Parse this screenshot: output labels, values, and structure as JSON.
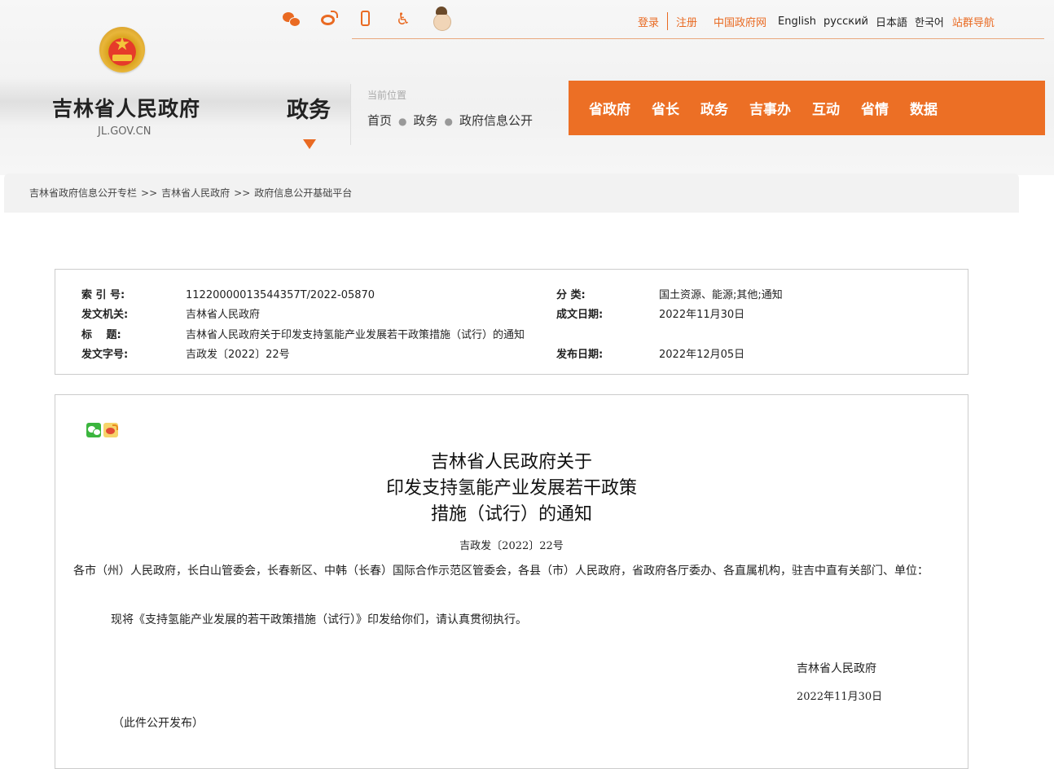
{
  "header": {
    "site_name": "吉林省人民政府",
    "site_domain": "JL.GOV.CN",
    "section_title": "政务",
    "location_label": "当前位置",
    "location_path": [
      "首页",
      "政务",
      "政府信息公开"
    ],
    "top_links": {
      "login": "登录",
      "register": "注册",
      "central_gov": "中国政府网",
      "english": "English",
      "russian": "русский",
      "japanese": "日本語",
      "korean": "한국어",
      "site_nav": "站群导航"
    },
    "icons": [
      "wechat-icon",
      "weibo-icon",
      "mobile-icon",
      "accessibility-icon",
      "elderly-mode-icon"
    ],
    "accent_color": "#ec6f25"
  },
  "main_nav": [
    "省政府",
    "省长",
    "政务",
    "吉事办",
    "互动",
    "省情",
    "数据"
  ],
  "breadcrumb": {
    "items": [
      "吉林省政府信息公开专栏",
      "吉林省人民政府",
      "政府信息公开基础平台"
    ],
    "separator": ">>"
  },
  "info": {
    "index_label": "索 引 号:",
    "index_value": "11220000013544357T/2022-05870",
    "category_label": "分 类:",
    "category_value": "国土资源、能源;其他;通知",
    "issuer_label": "发文机关:",
    "issuer_value": "吉林省人民政府",
    "written_date_label": "成文日期:",
    "written_date_value": "2022年11月30日",
    "title_label": "标　  题:",
    "title_value": "吉林省人民政府关于印发支持氢能产业发展若干政策措施（试行）的通知",
    "doc_number_label": "发文字号:",
    "doc_number_value": "吉政发〔2022〕22号",
    "publish_date_label": "发布日期:",
    "publish_date_value": "2022年12月05日"
  },
  "document": {
    "title_lines": [
      "吉林省人民政府关于",
      "印发支持氢能产业发展若干政策",
      "措施（试行）的通知"
    ],
    "number": "吉政发〔2022〕22号",
    "recipients": "各市（州）人民政府，长白山管委会，长春新区、中韩（长春）国际合作示范区管委会，各县（市）人民政府，省政府各厅委办、各直属机构，驻吉中直有关部门、单位：",
    "body": "现将《支持氢能产业发展的若干政策措施（试行）》印发给你们，请认真贯彻执行。",
    "signer": "吉林省人民政府",
    "date": "2022年11月30日",
    "note": "（此件公开发布）"
  }
}
